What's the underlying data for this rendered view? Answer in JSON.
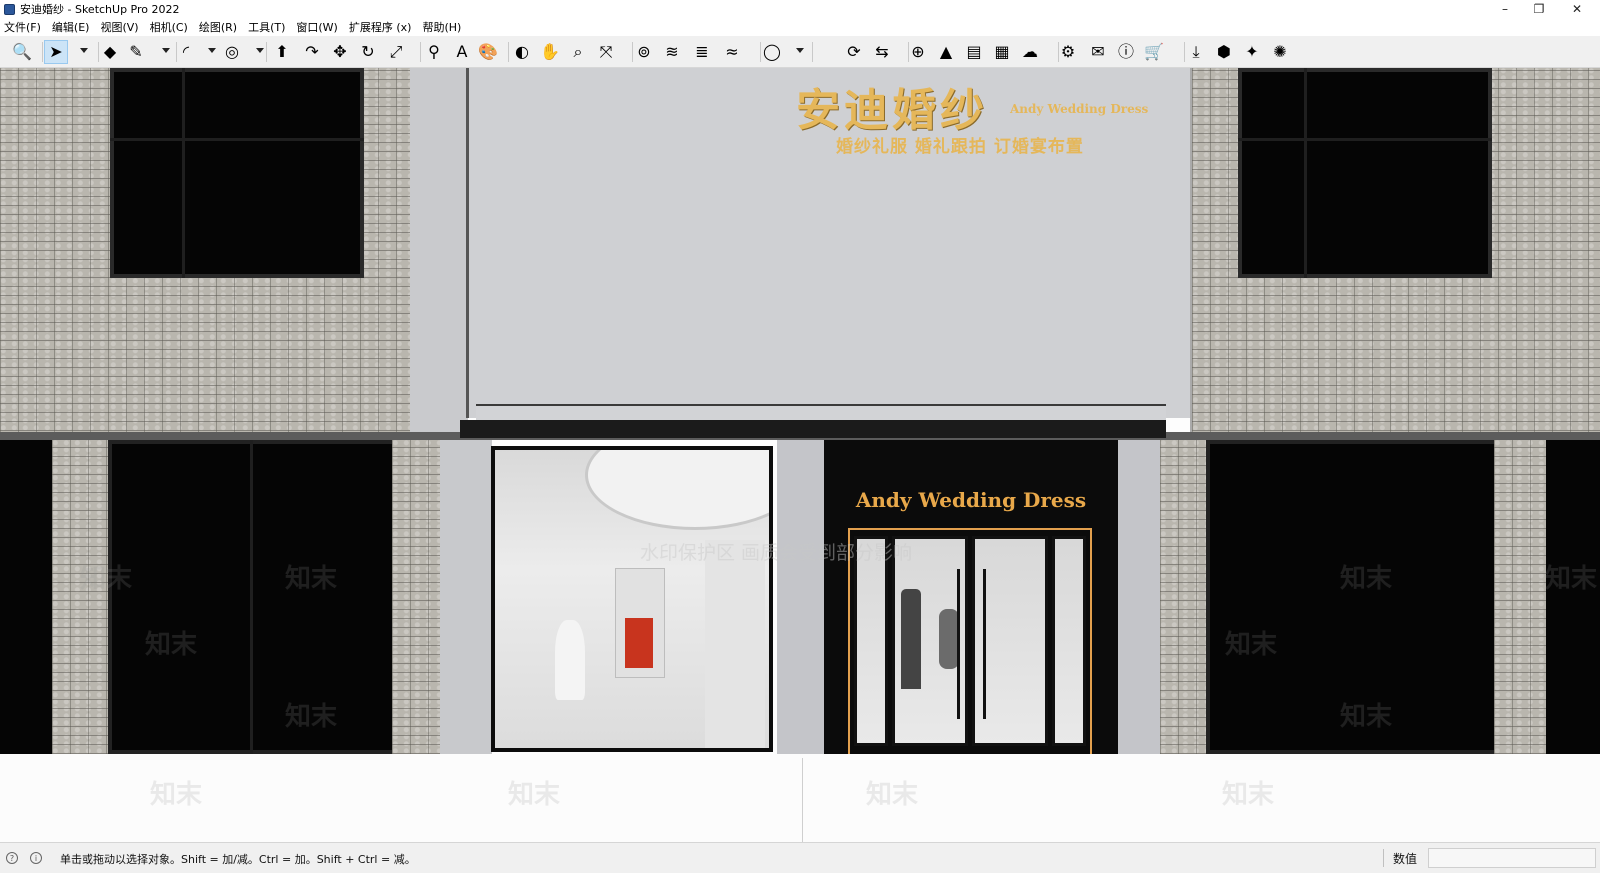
{
  "window": {
    "title": "安迪婚纱 - SketchUp Pro 2022",
    "controls": {
      "minimize": "–",
      "maximize": "❐",
      "close": "✕"
    }
  },
  "menu": [
    {
      "label": "文件(F)"
    },
    {
      "label": "编辑(E)"
    },
    {
      "label": "视图(V)"
    },
    {
      "label": "相机(C)"
    },
    {
      "label": "绘图(R)"
    },
    {
      "label": "工具(T)"
    },
    {
      "label": "窗口(W)"
    },
    {
      "label": "扩展程序 (x)"
    },
    {
      "label": "帮助(H)"
    }
  ],
  "toolbar": {
    "tools": [
      {
        "name": "zoom-icon",
        "glyph": "🔍"
      },
      {
        "name": "select-icon",
        "glyph": "➤",
        "selected": true
      },
      {
        "name": "eraser-icon",
        "glyph": "◆"
      },
      {
        "name": "pencil-line-icon",
        "glyph": "✎"
      },
      {
        "name": "arc-icon",
        "glyph": "◜"
      },
      {
        "name": "shape-icon",
        "glyph": "◎"
      },
      {
        "name": "push-pull-icon",
        "glyph": "⬆"
      },
      {
        "name": "follow-me-icon",
        "glyph": "↷"
      },
      {
        "name": "move-icon",
        "glyph": "✥"
      },
      {
        "name": "rotate-icon",
        "glyph": "↻"
      },
      {
        "name": "scale-icon",
        "glyph": "⤢"
      },
      {
        "name": "tape-measure-icon",
        "glyph": "⚲"
      },
      {
        "name": "text-icon",
        "glyph": "A"
      },
      {
        "name": "paint-bucket-icon",
        "glyph": "🎨"
      },
      {
        "name": "orbit-icon",
        "glyph": "◐"
      },
      {
        "name": "pan-icon",
        "glyph": "✋"
      },
      {
        "name": "zoom-window-icon",
        "glyph": "⌕"
      },
      {
        "name": "zoom-extents-icon",
        "glyph": "⤧"
      },
      {
        "name": "warehouse-icon",
        "glyph": "⊚"
      },
      {
        "name": "extension-warehouse-icon",
        "glyph": "≋"
      },
      {
        "name": "layout-icon",
        "glyph": "≣"
      },
      {
        "name": "extension-manager-icon",
        "glyph": "≈"
      },
      {
        "name": "user-account-icon",
        "glyph": "◯"
      },
      {
        "name": "sync-icon",
        "glyph": "⟳"
      },
      {
        "name": "export-icon",
        "glyph": "⇆"
      },
      {
        "name": "add-icon",
        "glyph": "⊕"
      },
      {
        "name": "tree-icon",
        "glyph": "▲"
      },
      {
        "name": "layers-icon",
        "glyph": "▤"
      },
      {
        "name": "checker-icon",
        "glyph": "▦"
      },
      {
        "name": "cloud-upload-icon",
        "glyph": "☁"
      },
      {
        "name": "settings-icon",
        "glyph": "⚙"
      },
      {
        "name": "mail-icon",
        "glyph": "✉"
      },
      {
        "name": "info-icon",
        "glyph": "ⓘ"
      },
      {
        "name": "cart-icon",
        "glyph": "🛒"
      },
      {
        "name": "download-icon",
        "glyph": "⤓"
      },
      {
        "name": "component-icon",
        "glyph": "⬢"
      },
      {
        "name": "plugin-icon",
        "glyph": "✦"
      },
      {
        "name": "plugin-settings-icon",
        "glyph": "✺"
      }
    ]
  },
  "scene": {
    "sign_cn": "安迪婚纱",
    "sign_en_small": "Andy Wedding Dress",
    "sign_sub": "婚纱礼服  婚礼跟拍  订婚宴布置",
    "door_sign": "Andy Wedding Dress",
    "watermark": "知末",
    "watermark_banner": "水印保护区 画质会受到部分影响"
  },
  "statusbar": {
    "message": "单击或拖动以选择对象。Shift = 加/减。Ctrl = 加。Shift + Ctrl = 减。",
    "value_label": "数值",
    "value": ""
  },
  "colors": {
    "gold": "#e5b75a",
    "door_frame": "#e3a04e",
    "wall_grey": "#c4c5c9",
    "brick": "#b9b6ae"
  }
}
